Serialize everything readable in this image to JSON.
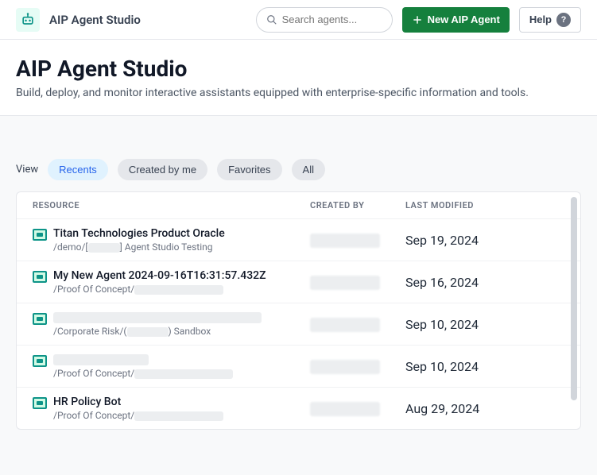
{
  "header": {
    "app_title": "AIP Agent Studio",
    "search_placeholder": "Search agents...",
    "new_button": "New AIP Agent",
    "help_button": "Help"
  },
  "hero": {
    "title": "AIP Agent Studio",
    "subtitle": "Build, deploy, and monitor interactive assistants equipped with enterprise-specific information and tools."
  },
  "view": {
    "label": "View",
    "tabs": [
      {
        "label": "Recents",
        "active": true
      },
      {
        "label": "Created by me",
        "active": false
      },
      {
        "label": "Favorites",
        "active": false
      },
      {
        "label": "All",
        "active": false
      }
    ]
  },
  "table": {
    "columns": {
      "resource": "RESOURCE",
      "created_by": "CREATED BY",
      "modified": "LAST MODIFIED"
    },
    "rows": [
      {
        "title": "Titan Technologies Product Oracle",
        "title_redacted": false,
        "path_pre": "/demo/[",
        "path_mid_redact_w": 40,
        "path_post": "] Agent Studio Testing",
        "created_by": "",
        "modified": "Sep 19, 2024"
      },
      {
        "title": "My New Agent 2024-09-16T16:31:57.432Z",
        "title_redacted": false,
        "path_pre": "/Proof Of Concept/",
        "path_mid_redact_w": 112,
        "path_post": "",
        "created_by": "",
        "modified": "Sep 16, 2024"
      },
      {
        "title": "",
        "title_redacted": true,
        "title_redact_w": 262,
        "path_pre": "/Corporate Risk/(",
        "path_mid_redact_w": 52,
        "path_post": ") Sandbox",
        "created_by": "",
        "modified": "Sep 10, 2024"
      },
      {
        "title": "",
        "title_redacted": true,
        "title_redact_w": 120,
        "path_pre": "/Proof Of Concept/",
        "path_mid_redact_w": 124,
        "path_post": "",
        "created_by": "",
        "modified": "Sep 10, 2024"
      },
      {
        "title": "HR Policy Bot",
        "title_redacted": false,
        "path_pre": "/Proof Of Concept/",
        "path_mid_redact_w": 112,
        "path_post": "",
        "created_by": "",
        "modified": "Aug 29, 2024"
      }
    ]
  }
}
